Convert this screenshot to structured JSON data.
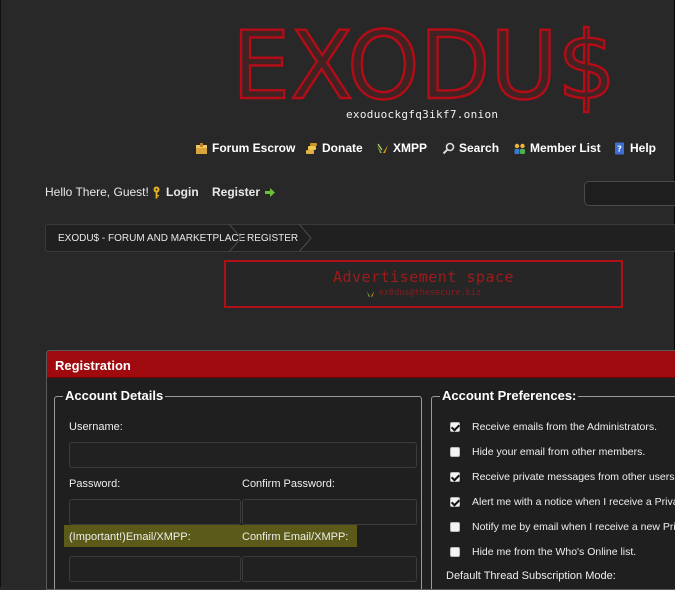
{
  "site": {
    "logo_text": "EXODU$",
    "onion": "exoduockgfq3ikf7.onion",
    "colors": {
      "accent": "#9f0a0f",
      "logo": "#b40d17"
    }
  },
  "nav": [
    {
      "label": "Forum Escrow",
      "icon": "escrow-box-icon"
    },
    {
      "label": "Donate",
      "icon": "donate-coins-icon"
    },
    {
      "label": "XMPP",
      "icon": "xmpp-icon"
    },
    {
      "label": "Search",
      "icon": "search-icon"
    },
    {
      "label": "Member List",
      "icon": "member-list-icon"
    },
    {
      "label": "Help",
      "icon": "help-book-icon"
    }
  ],
  "header": {
    "greeting": "Hello There, Guest!",
    "login": "Login",
    "register": "Register"
  },
  "breadcrumb": [
    "EXODU$ - FORUM AND MARKETPLACE",
    "REGISTER"
  ],
  "ad": {
    "title": "Advertisement space",
    "link": "ex0dus@thesecure.biz"
  },
  "registration": {
    "title": "Registration",
    "account_details": {
      "legend": "Account Details",
      "username_label": "Username:",
      "username_value": "",
      "password_label": "Password:",
      "confirm_password_label": "Confirm Password:",
      "email_label": "(Important!)Email/XMPP:",
      "confirm_email_label": "Confirm Email/XMPP:"
    },
    "preferences": {
      "legend": "Account Preferences:",
      "options": [
        {
          "label": "Receive emails from the Administrators.",
          "checked": true
        },
        {
          "label": "Hide your email from other members.",
          "checked": false
        },
        {
          "label": "Receive private messages from other users",
          "checked": true
        },
        {
          "label": "Alert me with a notice when I receive a Priva",
          "checked": true
        },
        {
          "label": "Notify me by email when I receive a new Pri",
          "checked": false
        },
        {
          "label": "Hide me from the Who's Online list.",
          "checked": false
        }
      ],
      "subscription_label": "Default Thread Subscription Mode:"
    }
  }
}
